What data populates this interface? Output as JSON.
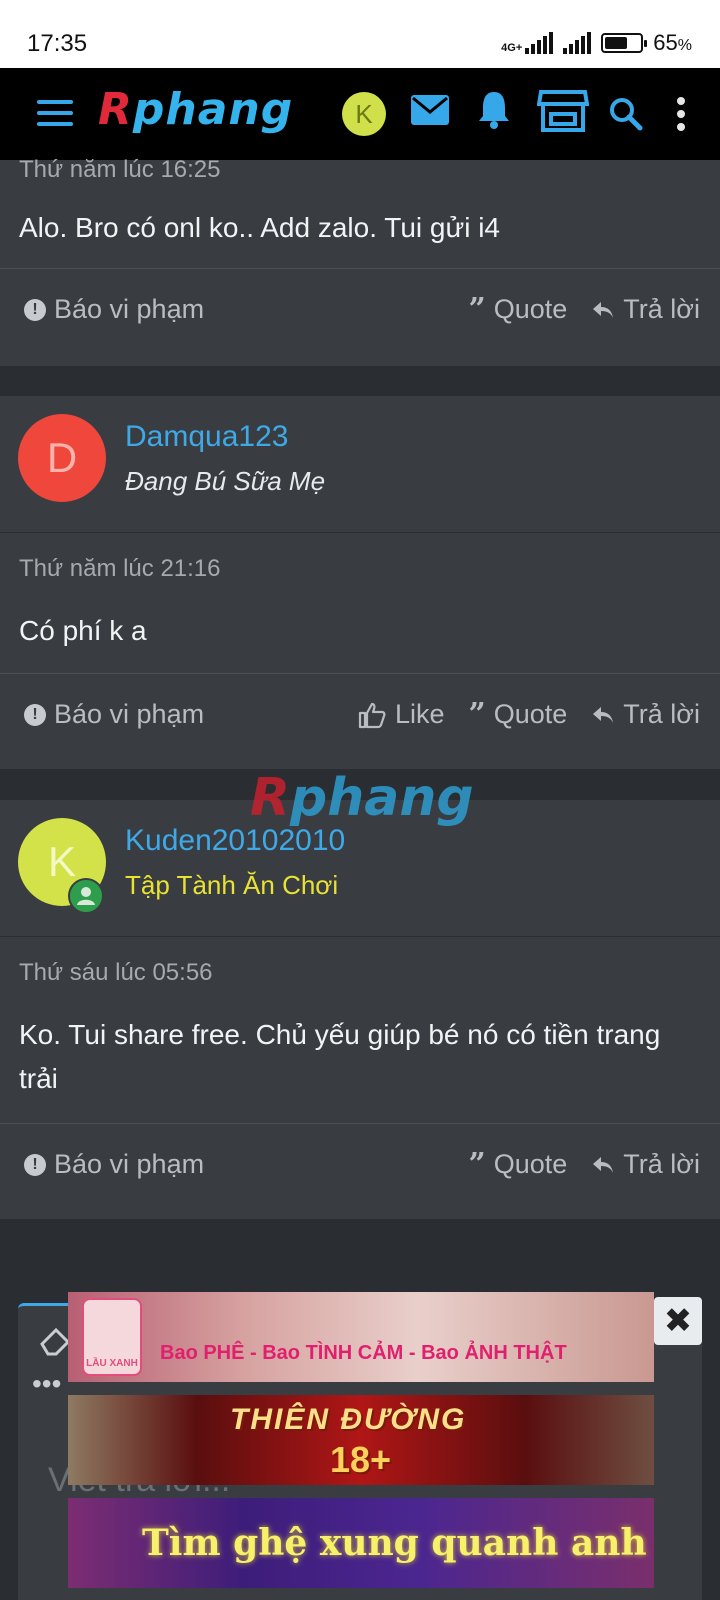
{
  "status_bar": {
    "time": "17:35",
    "network": "4G+",
    "battery": "65",
    "battery_unit": "%",
    "battery_level": 0.65
  },
  "top_bar": {
    "logo_first": "R",
    "logo_rest": "phang",
    "user_initial": "K"
  },
  "posts": [
    {
      "timestamp": "Thứ năm lúc 16:25",
      "message": "Alo. Bro có onl ko.. Add zalo. Tui gửi i4",
      "report_label": "Báo vi phạm",
      "quote_label": "Quote",
      "reply_label": "Trả lời"
    },
    {
      "author": "Damqua123",
      "author_initial": "D",
      "author_title": "Đang Bú Sữa Mẹ",
      "timestamp": "Thứ năm lúc 21:16",
      "message": "Có phí k a",
      "report_label": "Báo vi phạm",
      "like_label": "Like",
      "quote_label": "Quote",
      "reply_label": "Trả lời"
    },
    {
      "author": "Kuden20102010",
      "author_initial": "K",
      "author_title": "Tập Tành Ăn Chơi",
      "timestamp": "Thứ sáu lúc 05:56",
      "message": "Ko. Tui share free. Chủ yếu giúp bé nó có tiền trang trải",
      "report_label": "Báo vi phạm",
      "quote_label": "Quote",
      "reply_label": "Trả lời"
    }
  ],
  "watermark": {
    "first": "R",
    "rest": "phang"
  },
  "editor": {
    "placeholder": "Viết trả lời..."
  },
  "ads": {
    "ad1_brand": "LẦU XANH",
    "ad1_text": "Bao PHÊ - Bao TÌNH CẢM - Bao ẢNH THẬT",
    "ad2_line1": "THIÊN ĐƯỜNG",
    "ad2_line2": "18+",
    "ad3_text": "Tìm ghệ xung quanh anh",
    "close": "✖"
  },
  "colors": {
    "accent": "#3fa9e8",
    "card_bg": "#393d42",
    "page_bg": "#2a2d31",
    "brand_red": "#e02a3a",
    "title_yellow": "#e8e233"
  }
}
